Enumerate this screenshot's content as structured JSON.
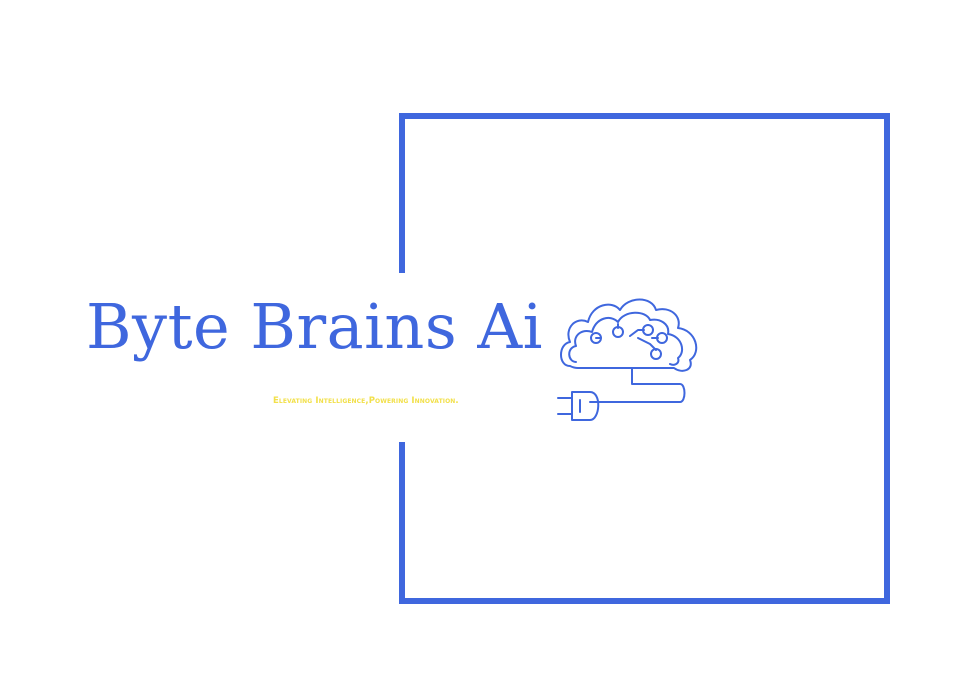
{
  "brand": {
    "name": "Byte Brains Ai",
    "tagline": "Elevating Intelligence,Powering Innovation."
  },
  "colors": {
    "primary": "#3f67de",
    "tagline": "#f2e04a",
    "background": "#ffffff"
  },
  "icons": {
    "logo": "brain-plug-icon"
  }
}
